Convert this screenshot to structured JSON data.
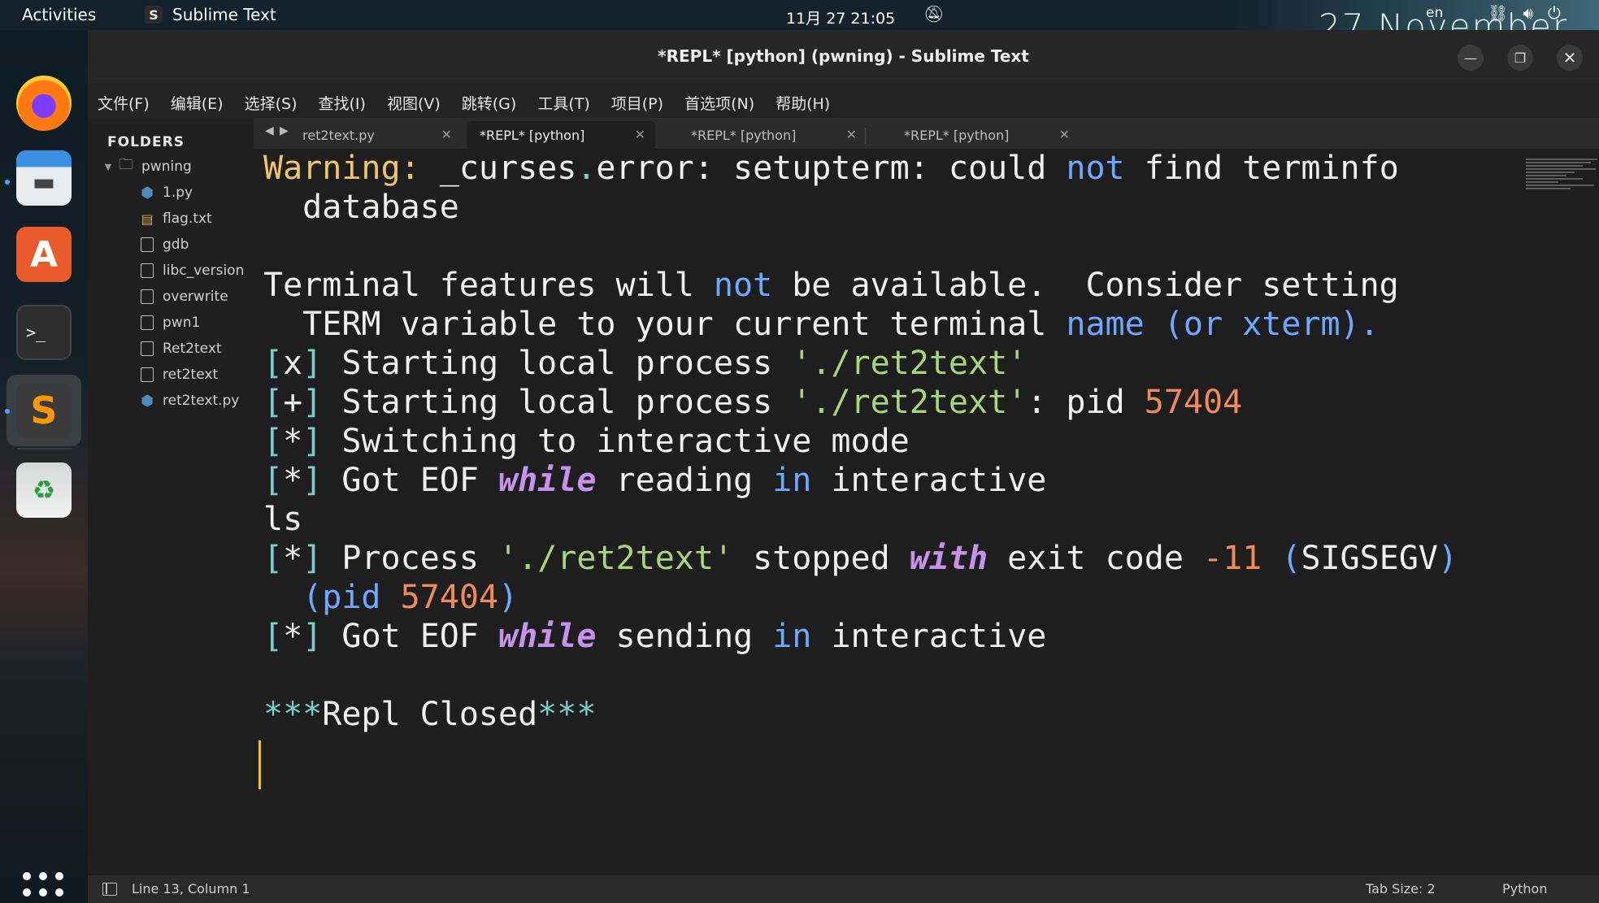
{
  "topbar": {
    "activities": "Activities",
    "app_name": "Sublime Text",
    "clock": "11月 27  21:05",
    "date_overlay": "27 November",
    "lang": "en"
  },
  "window": {
    "title": "*REPL* [python] (pwning) - Sublime Text"
  },
  "menu": [
    "文件(F)",
    "编辑(E)",
    "选择(S)",
    "查找(I)",
    "视图(V)",
    "跳转(G)",
    "工具(T)",
    "项目(P)",
    "首选项(N)",
    "帮助(H)"
  ],
  "sidebar": {
    "header": "FOLDERS",
    "folder": "pwning",
    "files": [
      "1.py",
      "flag.txt",
      "gdb",
      "libc_version",
      "overwrite",
      "pwn1",
      "Ret2text",
      "ret2text",
      "ret2text.py"
    ]
  },
  "tabs": [
    "ret2text.py",
    "*REPL* [python]",
    "*REPL* [python]",
    "*REPL* [python]"
  ],
  "editor": {
    "pid": "57404",
    "exit_code": "-11"
  },
  "statusbar": {
    "position": "Line 13, Column 1",
    "tab_size": "Tab Size: 2",
    "syntax": "Python"
  },
  "colors": {
    "accent_cursor": "#f6c20a",
    "keyword_blue": "#6fa8ff",
    "number_orange": "#f08a5d",
    "keyword_purple": "#c792ea"
  }
}
